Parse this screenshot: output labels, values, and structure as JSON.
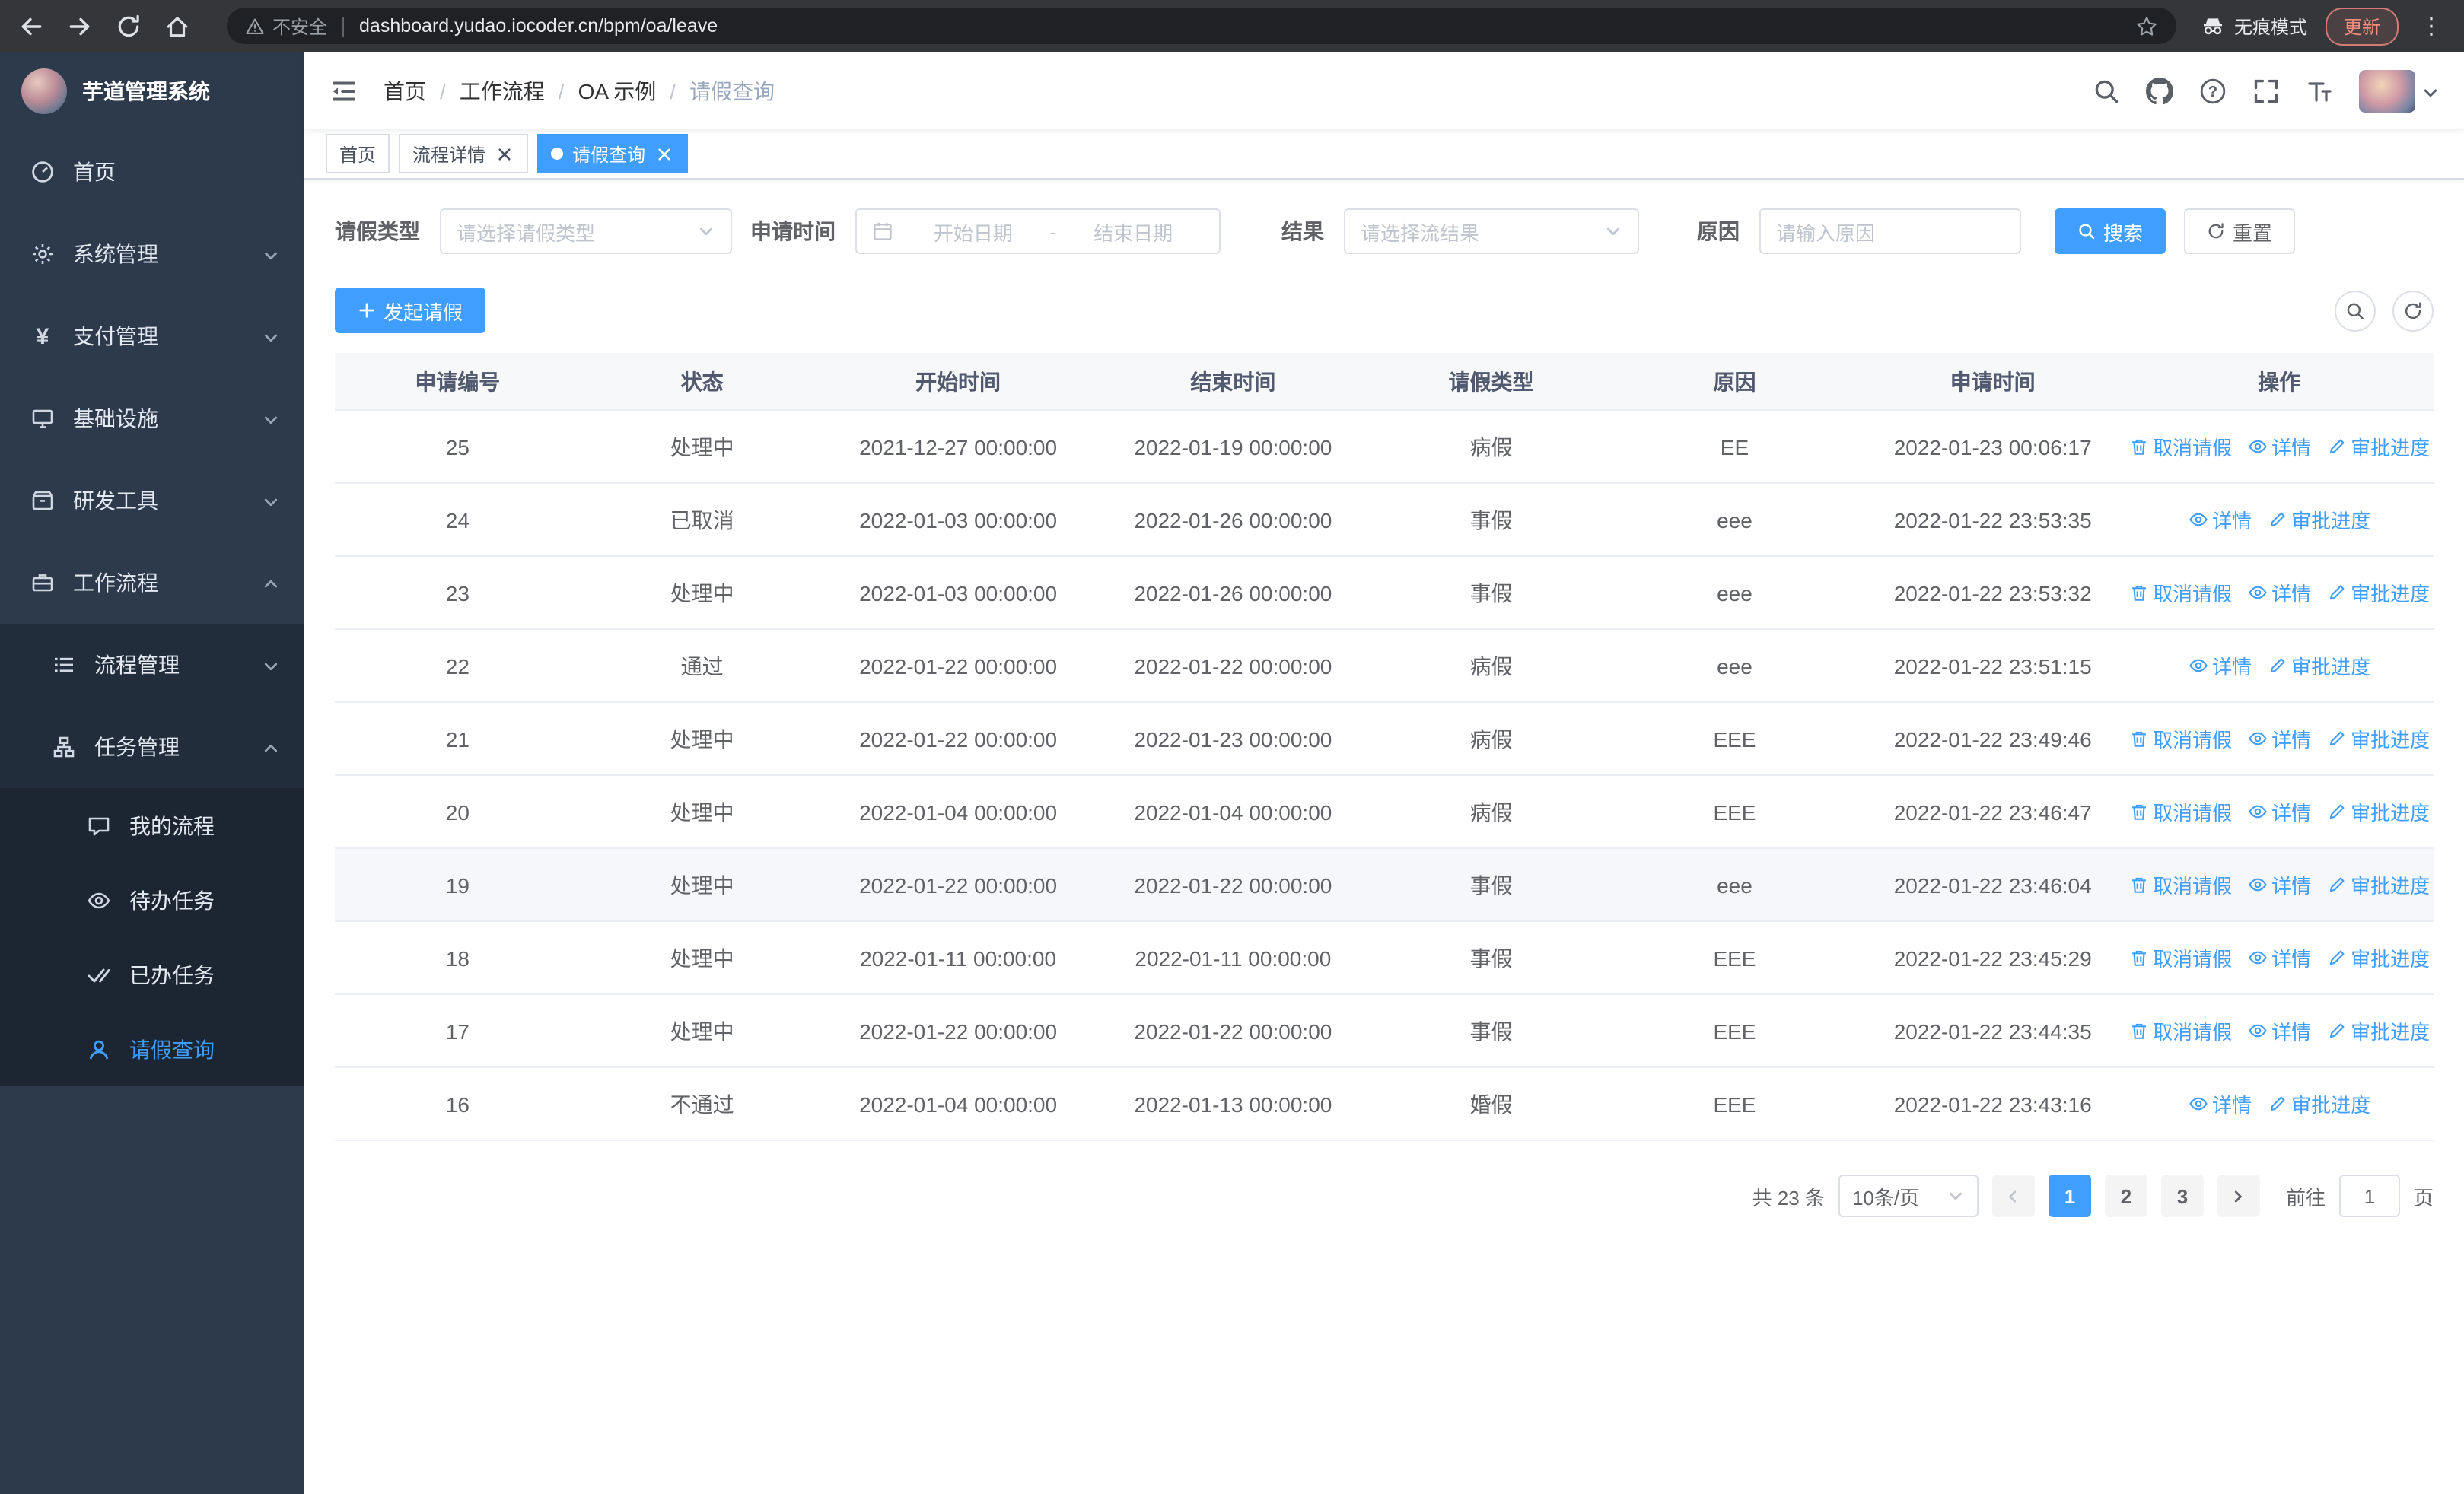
{
  "browser": {
    "security_label": "不安全",
    "url": "dashboard.yudao.iocoder.cn/bpm/oa/leave",
    "incognito_label": "无痕模式",
    "update_label": "更新"
  },
  "sidebar": {
    "logo_title": "芋道管理系统",
    "items": [
      {
        "label": "首页"
      },
      {
        "label": "系统管理"
      },
      {
        "label": "支付管理"
      },
      {
        "label": "基础设施"
      },
      {
        "label": "研发工具"
      },
      {
        "label": "工作流程"
      }
    ],
    "submenu": [
      {
        "label": "流程管理"
      },
      {
        "label": "任务管理"
      }
    ],
    "task_items": [
      {
        "label": "我的流程"
      },
      {
        "label": "待办任务"
      },
      {
        "label": "已办任务"
      },
      {
        "label": "请假查询"
      }
    ]
  },
  "header": {
    "breadcrumb": [
      "首页",
      "工作流程",
      "OA 示例",
      "请假查询"
    ],
    "separator": "/"
  },
  "tabs": [
    {
      "label": "首页"
    },
    {
      "label": "流程详情"
    },
    {
      "label": "请假查询"
    }
  ],
  "filters": {
    "leave_type_label": "请假类型",
    "leave_type_placeholder": "请选择请假类型",
    "apply_time_label": "申请时间",
    "start_date_placeholder": "开始日期",
    "range_separator": "-",
    "end_date_placeholder": "结束日期",
    "result_label": "结果",
    "result_placeholder": "请选择流结果",
    "reason_label": "原因",
    "reason_placeholder": "请输入原因",
    "search_button": "搜索",
    "reset_button": "重置"
  },
  "toolbar": {
    "create_button": "发起请假"
  },
  "table": {
    "columns": [
      "申请编号",
      "状态",
      "开始时间",
      "结束时间",
      "请假类型",
      "原因",
      "申请时间",
      "操作"
    ],
    "action_defs": {
      "cancel": {
        "label": "取消请假",
        "icon": "delete",
        "name": "cancel-leave-link"
      },
      "detail": {
        "label": "详情",
        "icon": "view",
        "name": "detail-link"
      },
      "progress": {
        "label": "审批进度",
        "icon": "edit",
        "name": "approval-progress-link"
      }
    },
    "rows": [
      {
        "id": "25",
        "status": "处理中",
        "start": "2021-12-27 00:00:00",
        "end": "2022-01-19 00:00:00",
        "type": "病假",
        "reason": "EE",
        "applied": "2022-01-23 00:06:17",
        "actions": [
          "cancel",
          "detail",
          "progress"
        ]
      },
      {
        "id": "24",
        "status": "已取消",
        "start": "2022-01-03 00:00:00",
        "end": "2022-01-26 00:00:00",
        "type": "事假",
        "reason": "eee",
        "applied": "2022-01-22 23:53:35",
        "actions": [
          "detail",
          "progress"
        ]
      },
      {
        "id": "23",
        "status": "处理中",
        "start": "2022-01-03 00:00:00",
        "end": "2022-01-26 00:00:00",
        "type": "事假",
        "reason": "eee",
        "applied": "2022-01-22 23:53:32",
        "actions": [
          "cancel",
          "detail",
          "progress"
        ]
      },
      {
        "id": "22",
        "status": "通过",
        "start": "2022-01-22 00:00:00",
        "end": "2022-01-22 00:00:00",
        "type": "病假",
        "reason": "eee",
        "applied": "2022-01-22 23:51:15",
        "actions": [
          "detail",
          "progress"
        ]
      },
      {
        "id": "21",
        "status": "处理中",
        "start": "2022-01-22 00:00:00",
        "end": "2022-01-23 00:00:00",
        "type": "病假",
        "reason": "EEE",
        "applied": "2022-01-22 23:49:46",
        "actions": [
          "cancel",
          "detail",
          "progress"
        ]
      },
      {
        "id": "20",
        "status": "处理中",
        "start": "2022-01-04 00:00:00",
        "end": "2022-01-04 00:00:00",
        "type": "病假",
        "reason": "EEE",
        "applied": "2022-01-22 23:46:47",
        "actions": [
          "cancel",
          "detail",
          "progress"
        ]
      },
      {
        "id": "19",
        "status": "处理中",
        "start": "2022-01-22 00:00:00",
        "end": "2022-01-22 00:00:00",
        "type": "事假",
        "reason": "eee",
        "applied": "2022-01-22 23:46:04",
        "actions": [
          "cancel",
          "detail",
          "progress"
        ],
        "highlighted": true
      },
      {
        "id": "18",
        "status": "处理中",
        "start": "2022-01-11 00:00:00",
        "end": "2022-01-11 00:00:00",
        "type": "事假",
        "reason": "EEE",
        "applied": "2022-01-22 23:45:29",
        "actions": [
          "cancel",
          "detail",
          "progress"
        ]
      },
      {
        "id": "17",
        "status": "处理中",
        "start": "2022-01-22 00:00:00",
        "end": "2022-01-22 00:00:00",
        "type": "事假",
        "reason": "EEE",
        "applied": "2022-01-22 23:44:35",
        "actions": [
          "cancel",
          "detail",
          "progress"
        ]
      },
      {
        "id": "16",
        "status": "不通过",
        "start": "2022-01-04 00:00:00",
        "end": "2022-01-13 00:00:00",
        "type": "婚假",
        "reason": "EEE",
        "applied": "2022-01-22 23:43:16",
        "actions": [
          "detail",
          "progress"
        ]
      }
    ]
  },
  "pagination": {
    "total_label": "共 23 条",
    "page_size": "10条/页",
    "pages": [
      "1",
      "2",
      "3"
    ],
    "active_page": "1",
    "goto_label": "前往",
    "goto_value": "1",
    "goto_unit": "页"
  }
}
